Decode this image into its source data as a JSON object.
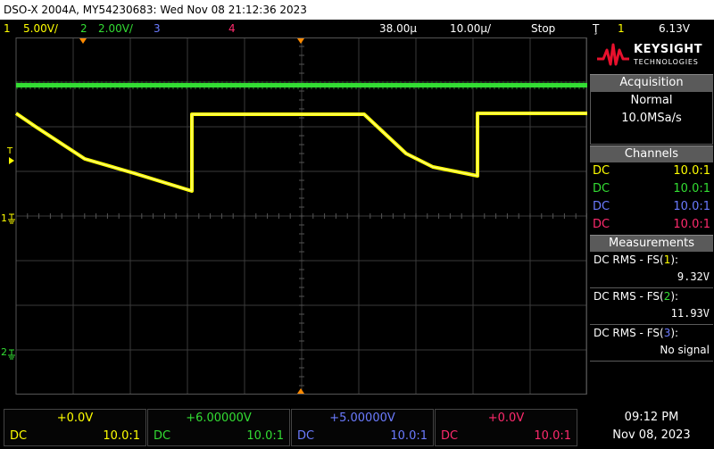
{
  "title_bar": "DSO-X 2004A, MY54230683: Wed Nov 08 21:12:36 2023",
  "status": {
    "ch1_num": "1",
    "ch1_scale": "5.00V/",
    "ch2_num": "2",
    "ch2_scale": "2.00V/",
    "ch3_num": "3",
    "ch4_num": "4",
    "delay": "38.00µ",
    "timebase": "10.00µ/",
    "run_state": "Stop",
    "trigger_symbol": "Ţ",
    "trigger_source": "1",
    "trigger_level": "6.13V"
  },
  "brand": {
    "name": "KEYSIGHT",
    "sub": "TECHNOLOGIES"
  },
  "acquisition": {
    "header": "Acquisition",
    "mode": "Normal",
    "rate": "10.0MSa/s"
  },
  "channels": {
    "header": "Channels",
    "rows": [
      {
        "coupling": "DC",
        "probe": "10.0:1"
      },
      {
        "coupling": "DC",
        "probe": "10.0:1"
      },
      {
        "coupling": "DC",
        "probe": "10.0:1"
      },
      {
        "coupling": "DC",
        "probe": "10.0:1"
      }
    ]
  },
  "measurements": {
    "header": "Measurements",
    "items": [
      {
        "label_pre": "DC RMS - FS(",
        "ch": "1",
        "label_post": "):",
        "value": "9.32V"
      },
      {
        "label_pre": "DC RMS - FS(",
        "ch": "2",
        "label_post": "):",
        "value": "11.93V"
      },
      {
        "label_pre": "DC RMS - FS(",
        "ch": "3",
        "label_post": "):",
        "value": "No signal"
      }
    ]
  },
  "markers": {
    "ch1": "1",
    "ch2": "2",
    "trigger_level_marker": "T"
  },
  "bottom_channels": [
    {
      "offset": "+0.0V",
      "coupling": "DC",
      "probe": "10.0:1"
    },
    {
      "offset": "+6.00000V",
      "coupling": "DC",
      "probe": "10.0:1"
    },
    {
      "offset": "+5.00000V",
      "coupling": "DC",
      "probe": "10.0:1"
    },
    {
      "offset": "+0.0V",
      "coupling": "DC",
      "probe": "10.0:1"
    }
  ],
  "clock": {
    "time": "09:12 PM",
    "date": "Nov 08, 2023"
  },
  "colors": {
    "ch1": "#ffff00",
    "ch2": "#33dd33",
    "ch3": "#6b7bff",
    "ch4": "#ff2a6d"
  }
}
